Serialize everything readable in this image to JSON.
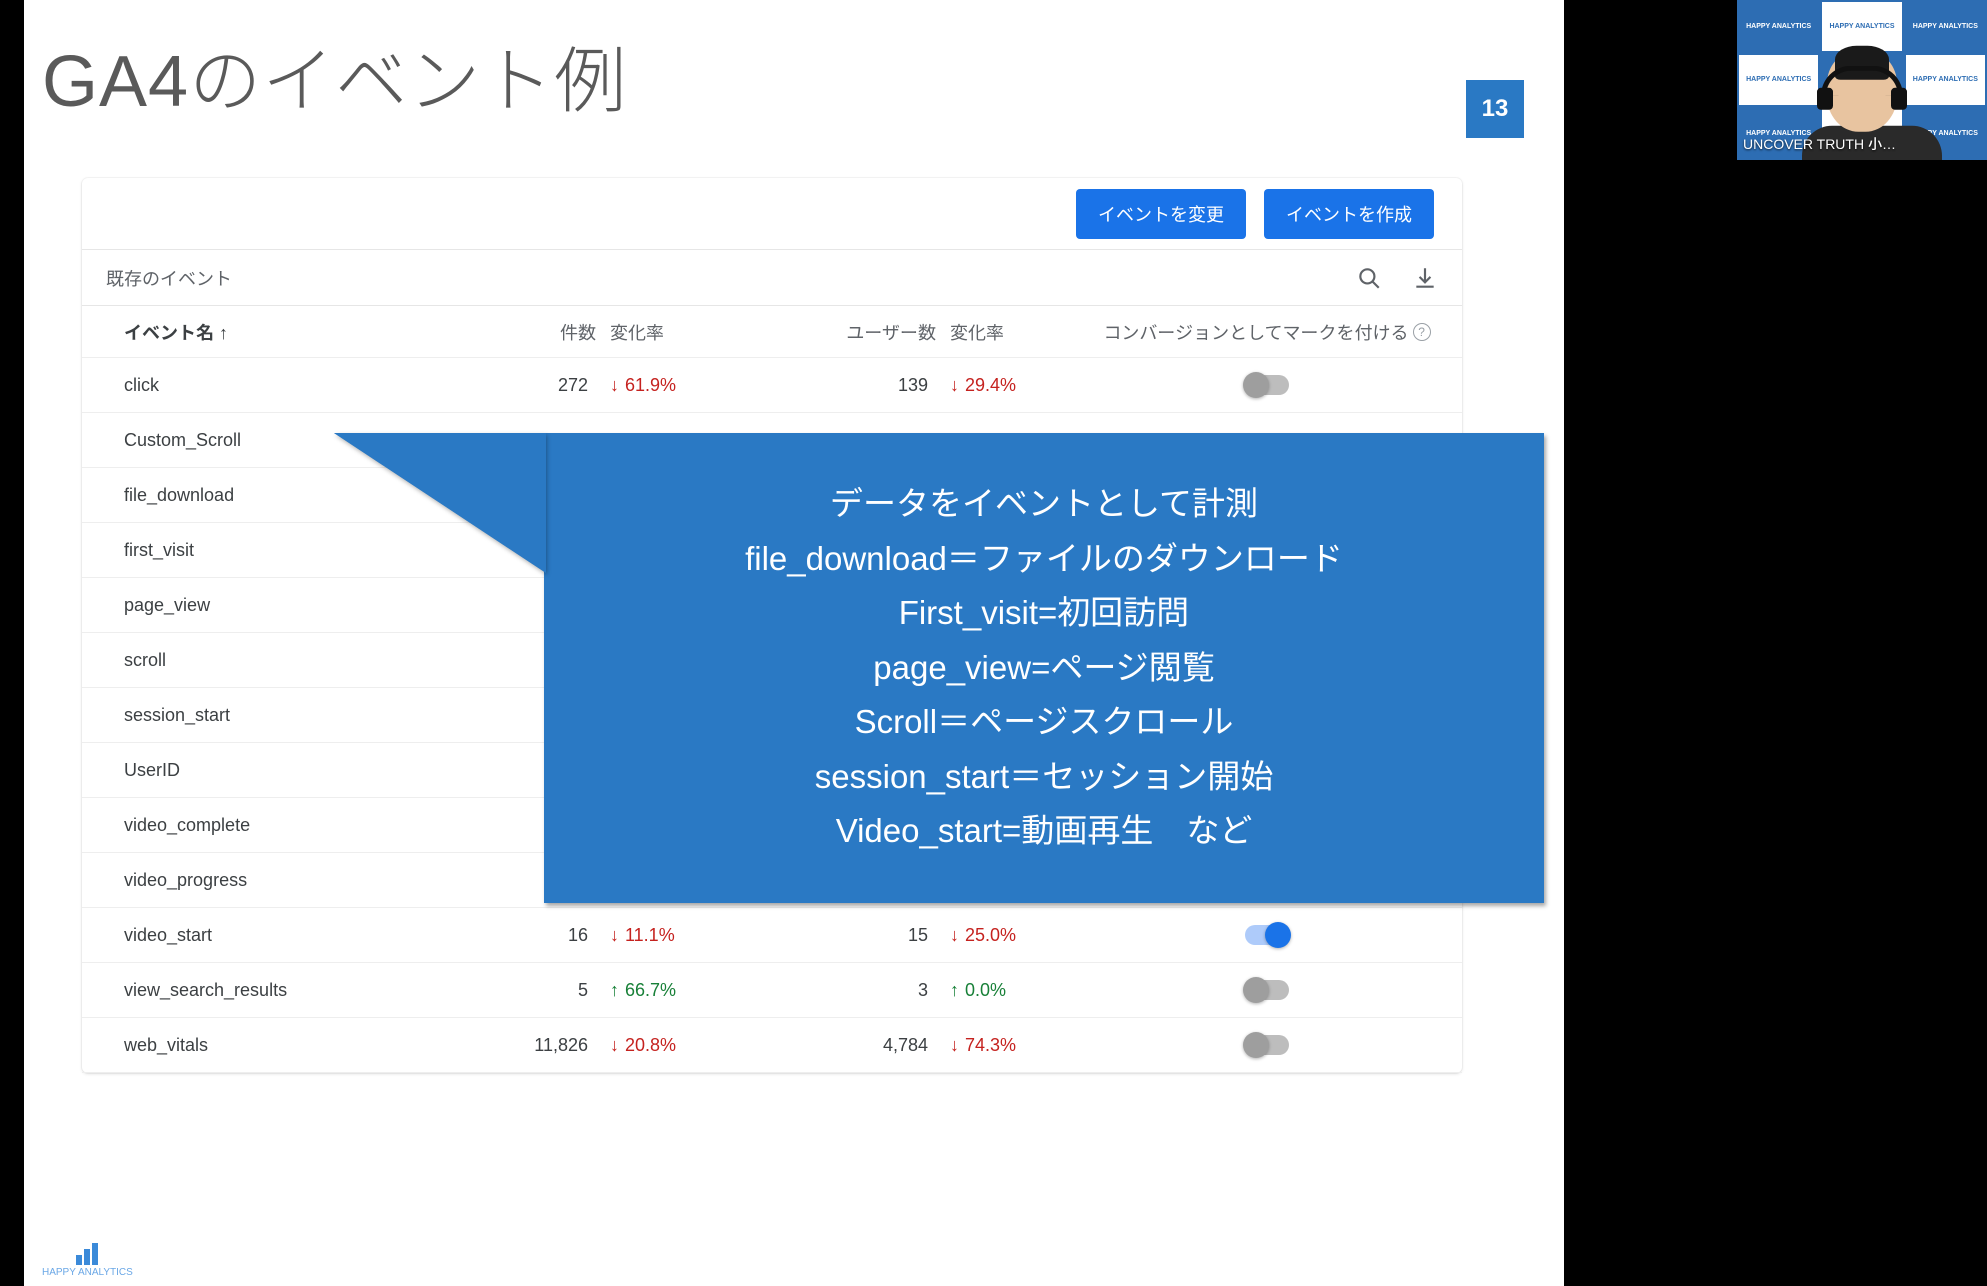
{
  "slide": {
    "title": "GA4のイベント例",
    "page_number": "13",
    "footer_brand": "HAPPY ANALYTICS"
  },
  "panel": {
    "buttons": {
      "modify": "イベントを変更",
      "create": "イベントを作成"
    },
    "toolbar_label": "既存のイベント",
    "headers": {
      "name": "イベント名 ↑",
      "count": "件数",
      "change": "変化率",
      "users": "ユーザー数",
      "users_change": "変化率",
      "conversion": "コンバージョンとしてマークを付ける"
    },
    "rows": [
      {
        "name": "click",
        "count": "272",
        "change_dir": "down",
        "change": "61.9%",
        "users": "139",
        "users_change_dir": "down",
        "users_change": "29.4%",
        "toggle": "off"
      },
      {
        "name": "Custom_Scroll"
      },
      {
        "name": "file_download"
      },
      {
        "name": "first_visit"
      },
      {
        "name": "page_view"
      },
      {
        "name": "scroll"
      },
      {
        "name": "session_start"
      },
      {
        "name": "UserID"
      },
      {
        "name": "video_complete"
      },
      {
        "name": "video_progress"
      },
      {
        "name": "video_start",
        "count": "16",
        "change_dir": "down",
        "change": "11.1%",
        "users": "15",
        "users_change_dir": "down",
        "users_change": "25.0%",
        "toggle": "on"
      },
      {
        "name": "view_search_results",
        "count": "5",
        "change_dir": "up",
        "change": "66.7%",
        "users": "3",
        "users_change_dir": "up",
        "users_change": "0.0%",
        "toggle": "off"
      },
      {
        "name": "web_vitals",
        "count": "11,826",
        "change_dir": "down",
        "change": "20.8%",
        "users": "4,784",
        "users_change_dir": "down",
        "users_change": "74.3%",
        "toggle": "off"
      }
    ]
  },
  "callout": {
    "l1": "データをイベントとして計測",
    "l2": "file_download＝ファイルのダウンロード",
    "l3": "First_visit=初回訪問",
    "l4": "page_view=ページ閲覧",
    "l5": "Scroll＝ページスクロール",
    "l6": "session_start＝セッション開始",
    "l7": "Video_start=動画再生　など"
  },
  "webcam": {
    "label": "UNCOVER TRUTH 小…",
    "tile": "HAPPY ANALYTICS"
  }
}
